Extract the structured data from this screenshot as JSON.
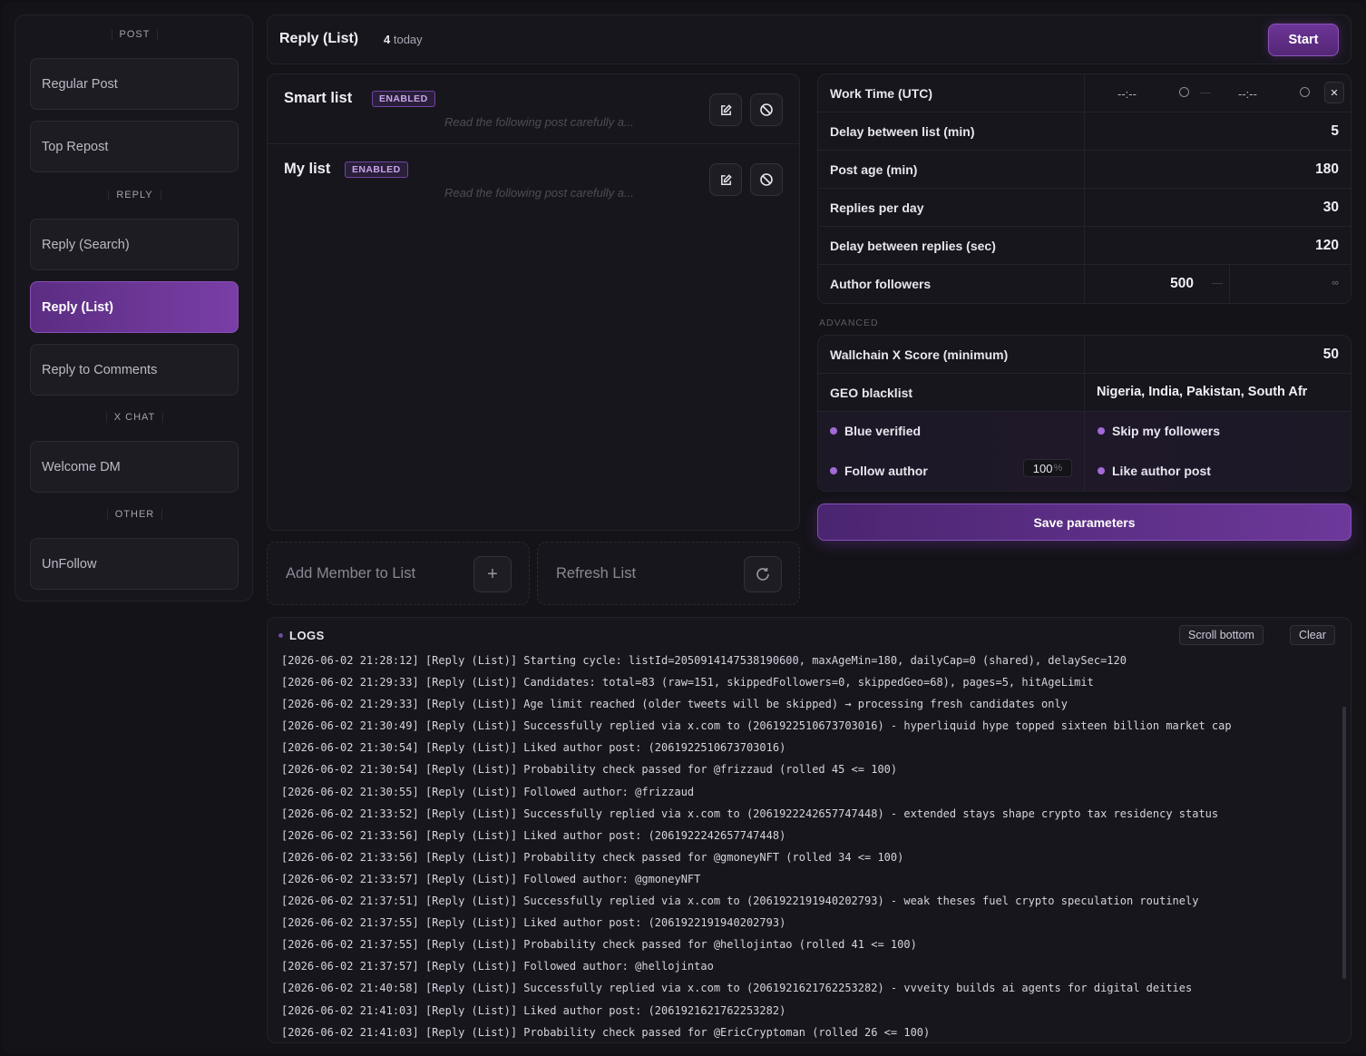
{
  "sidebar": {
    "sections": [
      {
        "label": "POST"
      },
      {
        "label": "REPLY"
      },
      {
        "label": "X CHAT"
      },
      {
        "label": "OTHER"
      }
    ],
    "items": [
      {
        "label": "Regular Post"
      },
      {
        "label": "Top Repost"
      },
      {
        "label": "Reply (Search)"
      },
      {
        "label": "Reply (List)",
        "active": true
      },
      {
        "label": "Reply to Comments"
      },
      {
        "label": "Welcome DM"
      },
      {
        "label": "UnFollow"
      }
    ]
  },
  "header": {
    "title": "Reply (List)",
    "count": "4",
    "count_suffix": "today",
    "start_label": "Start"
  },
  "lists": [
    {
      "name": "Smart list",
      "badge": "ENABLED",
      "desc": "Read the following post carefully a..."
    },
    {
      "name": "My list",
      "badge": "ENABLED",
      "desc": "Read the following post carefully a..."
    }
  ],
  "actions": {
    "add_member": "Add Member to List",
    "refresh": "Refresh List"
  },
  "params": {
    "work_time": {
      "label": "Work Time (UTC)",
      "start": "--:--",
      "end": "--:--"
    },
    "delay_list": {
      "label": "Delay between list (min)",
      "value": "5"
    },
    "post_age": {
      "label": "Post age (min)",
      "value": "180"
    },
    "replies_day": {
      "label": "Replies per day",
      "value": "30"
    },
    "delay_replies": {
      "label": "Delay between replies (sec)",
      "value": "120"
    },
    "author_followers": {
      "label": "Author followers",
      "min": "500",
      "max": "∞"
    }
  },
  "advanced": {
    "label": "ADVANCED",
    "wallchain": {
      "label": "Wallchain X Score (minimum)",
      "value": "50"
    },
    "geo": {
      "label": "GEO blacklist",
      "value": "Nigeria, India, Pakistan, South Afr"
    },
    "toggles": {
      "blue_verified": "Blue verified",
      "skip_followers": "Skip my followers",
      "follow_author": "Follow author",
      "follow_pct": "100",
      "pct_sign": "%",
      "like_post": "Like author post"
    },
    "save_label": "Save parameters"
  },
  "logs": {
    "title": "LOGS",
    "scroll_bottom": "Scroll bottom",
    "clear": "Clear",
    "lines": [
      "[2026-06-02 21:28:12] [Reply (List)] Starting cycle: listId=2050914147538190600, maxAgeMin=180, dailyCap=0 (shared), delaySec=120",
      "[2026-06-02 21:29:33] [Reply (List)] Candidates: total=83 (raw=151, skippedFollowers=0, skippedGeo=68), pages=5, hitAgeLimit",
      "[2026-06-02 21:29:33] [Reply (List)] Age limit reached (older tweets will be skipped) → processing fresh candidates only",
      "[2026-06-02 21:30:49] [Reply (List)] Successfully replied via x.com to (2061922510673703016) - hyperliquid hype topped sixteen billion market cap",
      "[2026-06-02 21:30:54] [Reply (List)] Liked author post: (2061922510673703016)",
      "[2026-06-02 21:30:54] [Reply (List)] Probability check passed for @frizzaud (rolled 45 <= 100)",
      "[2026-06-02 21:30:55] [Reply (List)] Followed author: @frizzaud",
      "[2026-06-02 21:33:52] [Reply (List)] Successfully replied via x.com to (2061922242657747448) - extended stays shape crypto tax residency status",
      "[2026-06-02 21:33:56] [Reply (List)] Liked author post: (2061922242657747448)",
      "[2026-06-02 21:33:56] [Reply (List)] Probability check passed for @gmoneyNFT (rolled 34 <= 100)",
      "[2026-06-02 21:33:57] [Reply (List)] Followed author: @gmoneyNFT",
      "[2026-06-02 21:37:51] [Reply (List)] Successfully replied via x.com to (2061922191940202793) - weak theses fuel crypto speculation routinely",
      "[2026-06-02 21:37:55] [Reply (List)] Liked author post: (2061922191940202793)",
      "[2026-06-02 21:37:55] [Reply (List)] Probability check passed for @hellojintao (rolled 41 <= 100)",
      "[2026-06-02 21:37:57] [Reply (List)] Followed author: @hellojintao",
      "[2026-06-02 21:40:58] [Reply (List)] Successfully replied via x.com to (2061921621762253282) - vvveity builds ai agents for digital deities",
      "[2026-06-02 21:41:03] [Reply (List)] Liked author post: (2061921621762253282)",
      "[2026-06-02 21:41:03] [Reply (List)] Probability check passed for @EricCryptoman (rolled 26 <= 100)"
    ]
  }
}
